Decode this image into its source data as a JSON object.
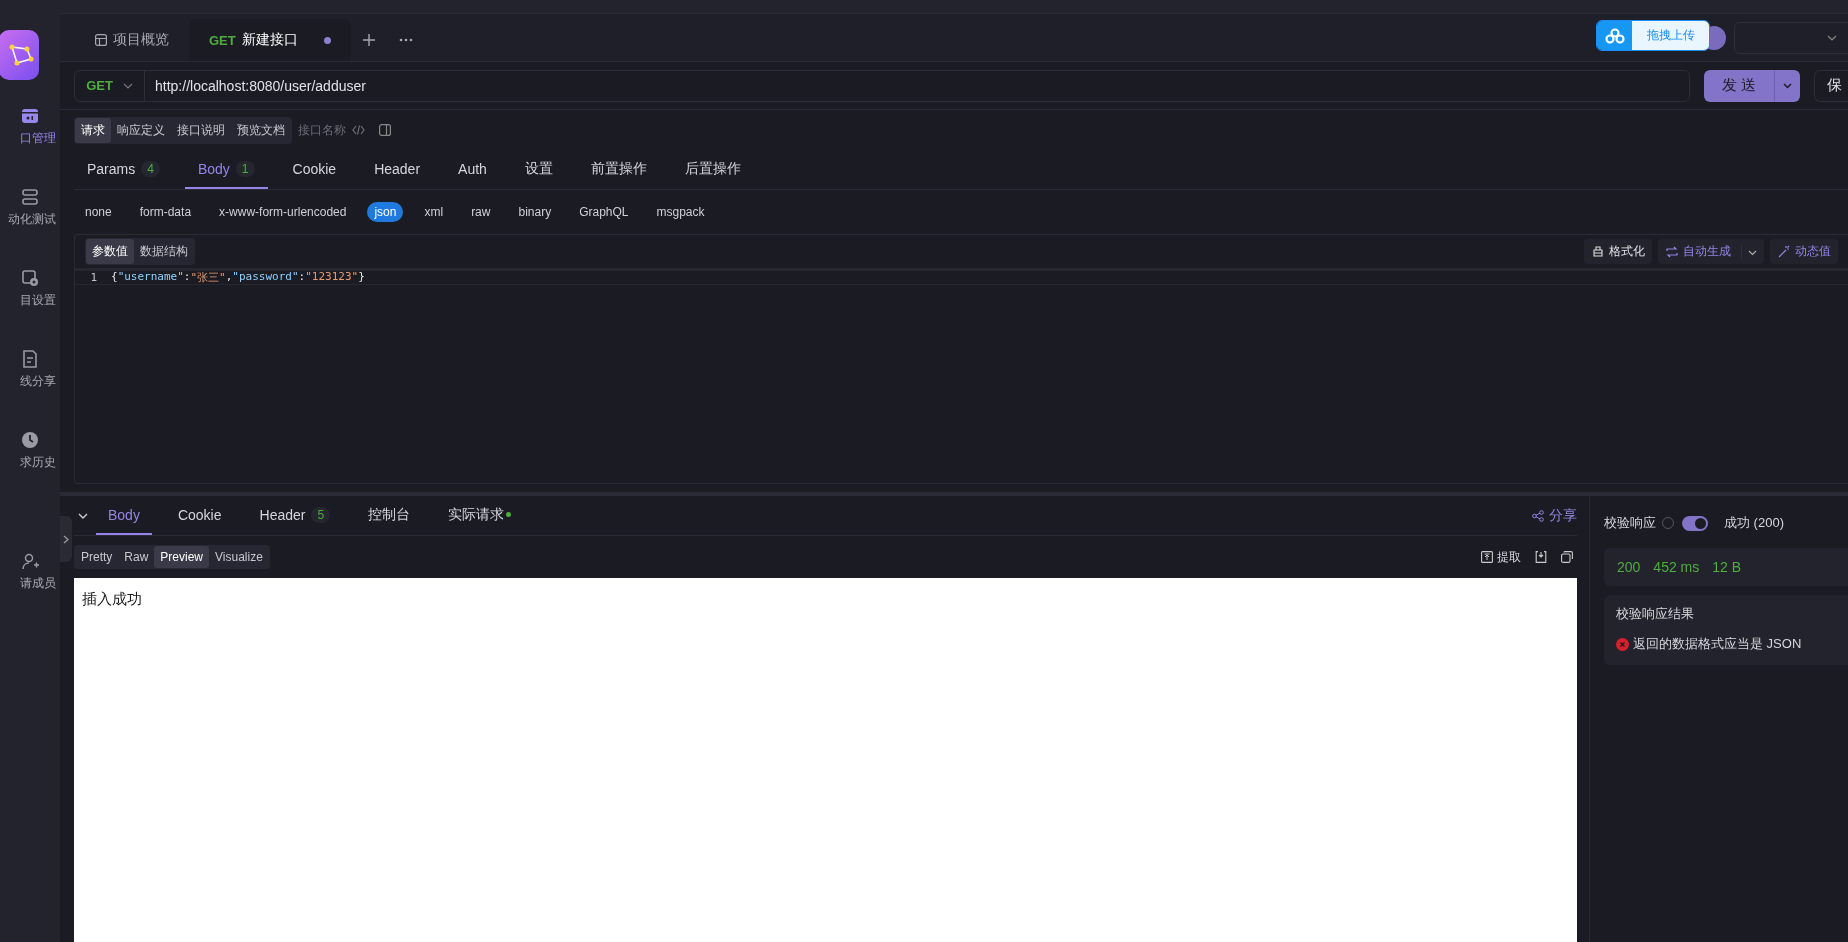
{
  "sidebar": {
    "items": [
      {
        "label": "口管理",
        "selected": true
      },
      {
        "label": "动化测试",
        "selected": false
      },
      {
        "label": "目设置",
        "selected": false
      },
      {
        "label": "线分享",
        "selected": false
      },
      {
        "label": "求历史",
        "selected": false
      },
      {
        "label": "请成员",
        "selected": false
      }
    ]
  },
  "tabs": [
    {
      "kind": "overview",
      "label": "项目概览",
      "selected": false
    },
    {
      "kind": "request",
      "method": "GET",
      "label": "新建接口",
      "selected": true,
      "modified": true
    }
  ],
  "upload_popup": {
    "label": "拖拽上传"
  },
  "request": {
    "method": "GET",
    "url": "http://localhost:8080/user/adduser",
    "send": "发 送",
    "save": "保"
  },
  "view_tabs": [
    {
      "label": "请求",
      "selected": true
    },
    {
      "label": "响应定义",
      "selected": false
    },
    {
      "label": "接口说明",
      "selected": false
    },
    {
      "label": "预览文档",
      "selected": false
    }
  ],
  "api_name": {
    "placeholder": "接口名称"
  },
  "param_tabs": [
    {
      "label": "Params",
      "badge": "4",
      "selected": false
    },
    {
      "label": "Body",
      "badge": "1",
      "selected": true
    },
    {
      "label": "Cookie",
      "selected": false
    },
    {
      "label": "Header",
      "selected": false
    },
    {
      "label": "Auth",
      "selected": false
    },
    {
      "label": "设置",
      "selected": false
    },
    {
      "label": "前置操作",
      "selected": false
    },
    {
      "label": "后置操作",
      "selected": false
    }
  ],
  "body_types": [
    {
      "label": "none",
      "selected": false
    },
    {
      "label": "form-data",
      "selected": false
    },
    {
      "label": "x-www-form-urlencoded",
      "selected": false
    },
    {
      "label": "json",
      "selected": true
    },
    {
      "label": "xml",
      "selected": false
    },
    {
      "label": "raw",
      "selected": false
    },
    {
      "label": "binary",
      "selected": false
    },
    {
      "label": "GraphQL",
      "selected": false
    },
    {
      "label": "msgpack",
      "selected": false
    }
  ],
  "editor": {
    "modes": [
      {
        "label": "参数值",
        "selected": true
      },
      {
        "label": "数据结构",
        "selected": false
      }
    ],
    "tools": [
      {
        "kind": "format",
        "label": "格式化"
      },
      {
        "kind": "generate",
        "label": "自动生成"
      },
      {
        "kind": "dynamic",
        "label": "动态值"
      }
    ],
    "lines": [
      {
        "number": "1",
        "code": "{\"username\":\"张三\",\"password\":\"123123\"}"
      }
    ]
  },
  "response": {
    "tabs": [
      {
        "label": "Body",
        "selected": true
      },
      {
        "label": "Cookie",
        "selected": false
      },
      {
        "label": "Header",
        "badge": "5",
        "selected": false
      },
      {
        "label": "控制台",
        "selected": false
      },
      {
        "label": "实际请求",
        "dot": true,
        "selected": false
      }
    ],
    "share": "分享",
    "formats": [
      {
        "label": "Pretty",
        "selected": false
      },
      {
        "label": "Raw",
        "selected": false
      },
      {
        "label": "Preview",
        "selected": true
      },
      {
        "label": "Visualize",
        "selected": false
      }
    ],
    "extract": "提取",
    "body": "插入成功"
  },
  "validation": {
    "label": "校验响应",
    "on": true,
    "status": "成功 (200)",
    "stats": [
      "200",
      "452 ms",
      "12 B"
    ],
    "result_title": "校验响应结果",
    "results": [
      {
        "kind": "error",
        "text": "返回的数据格式应当是 JSON"
      }
    ]
  }
}
